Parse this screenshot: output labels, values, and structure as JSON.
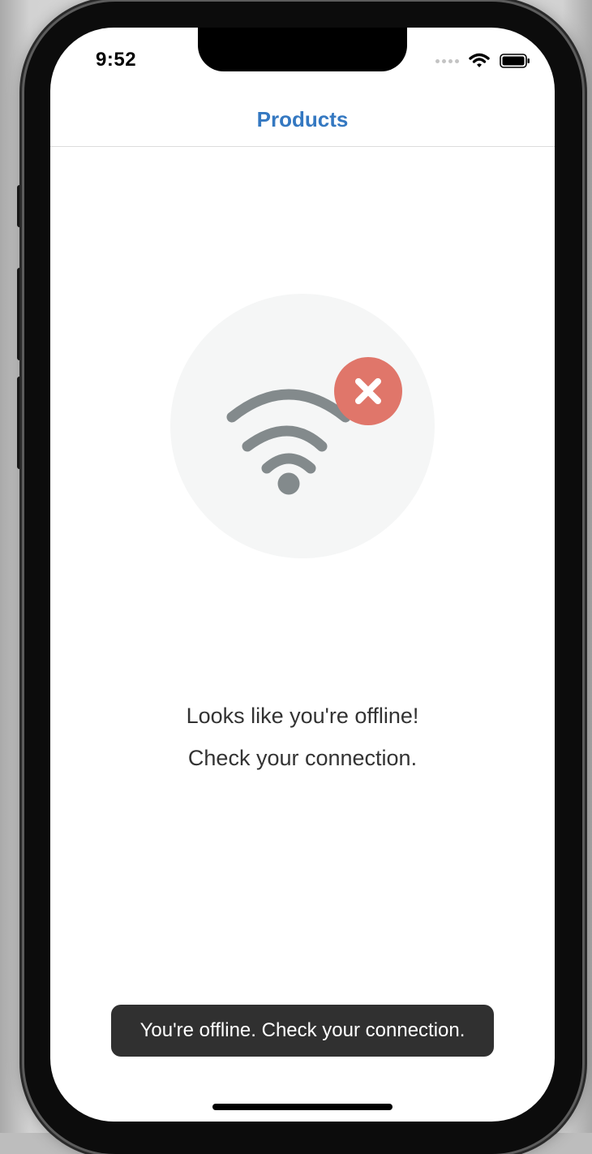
{
  "status_bar": {
    "time": "9:52",
    "wifi_icon": "wifi-icon",
    "battery_icon": "battery-icon"
  },
  "nav": {
    "title": "Products",
    "title_color": "#3478c1"
  },
  "offline_state": {
    "illustration_icon": "wifi-off-icon",
    "badge_icon": "close-icon",
    "badge_color": "#e0766a",
    "icon_color": "#838a8c",
    "line1": "Looks like you're offline!",
    "line2": "Check your connection."
  },
  "toast": {
    "message": "You're offline. Check your connection."
  }
}
